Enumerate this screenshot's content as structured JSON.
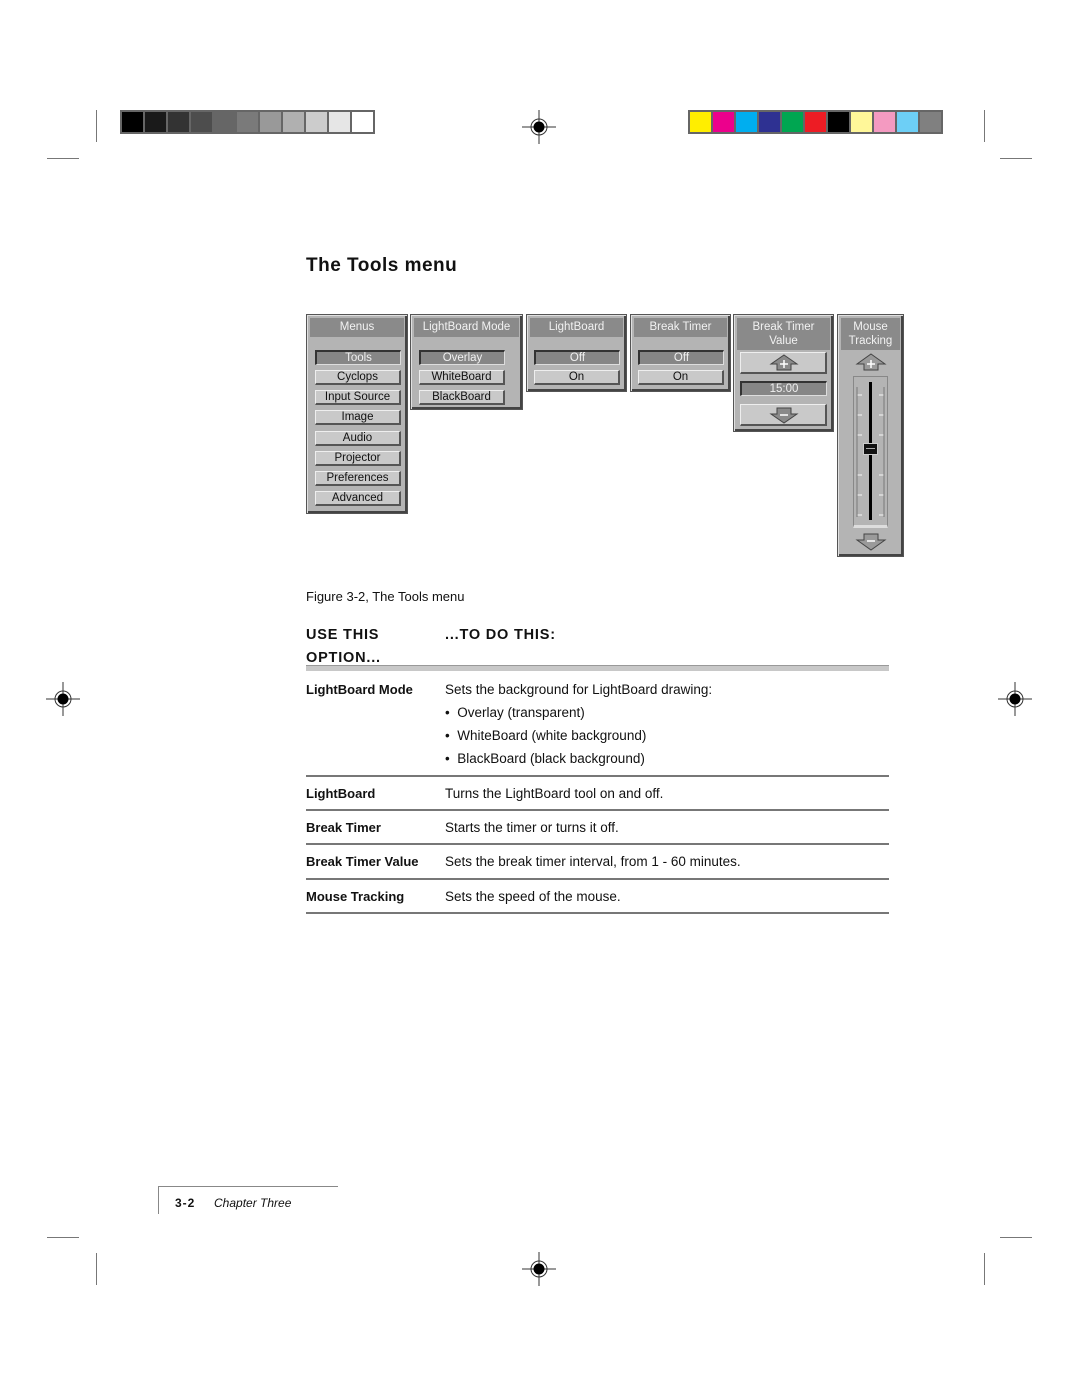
{
  "print_marks": {
    "grayscale_swatches": [
      "#000000",
      "#1a1a1a",
      "#333333",
      "#4d4d4d",
      "#666666",
      "#7a7a7a",
      "#999999",
      "#b0b0b0",
      "#cccccc",
      "#e6e6e6",
      "#ffffff"
    ],
    "color_swatches": [
      "#ffee00",
      "#ec008c",
      "#00aeef",
      "#2e3192",
      "#00a651",
      "#ed1c24",
      "#000000",
      "#fff799",
      "#f49ac1",
      "#6dcff6",
      "#808080"
    ]
  },
  "page_title": "The Tools menu",
  "figure": {
    "panels": {
      "menus": {
        "title": "Menus",
        "items": [
          {
            "label": "Tools",
            "selected": true
          },
          {
            "label": "Cyclops",
            "selected": false
          },
          {
            "label": "Input Source",
            "selected": false
          },
          {
            "label": "Image",
            "selected": false
          },
          {
            "label": "Audio",
            "selected": false
          },
          {
            "label": "Projector",
            "selected": false
          },
          {
            "label": "Preferences",
            "selected": false
          },
          {
            "label": "Advanced",
            "selected": false
          }
        ]
      },
      "lightboard_mode": {
        "title": "LightBoard Mode",
        "items": [
          {
            "label": "Overlay",
            "selected": true
          },
          {
            "label": "WhiteBoard",
            "selected": false
          },
          {
            "label": "BlackBoard",
            "selected": false
          }
        ]
      },
      "lightboard": {
        "title": "LightBoard",
        "items": [
          {
            "label": "Off",
            "selected": true
          },
          {
            "label": "On",
            "selected": false
          }
        ]
      },
      "break_timer": {
        "title": "Break Timer",
        "items": [
          {
            "label": "Off",
            "selected": true
          },
          {
            "label": "On",
            "selected": false
          }
        ]
      },
      "break_timer_value": {
        "title_line1": "Break Timer",
        "title_line2": "Value",
        "value": "15:00",
        "up_icon": "plus-up-arrow",
        "down_icon": "minus-down-arrow"
      },
      "mouse_tracking": {
        "title_line1": "Mouse",
        "title_line2": "Tracking",
        "slider_level_fraction": 0.5,
        "up_icon": "plus-up-arrow",
        "down_icon": "minus-down-arrow"
      }
    },
    "caption": "Figure 3-2, The Tools menu"
  },
  "table": {
    "header_col1_line1": "USE THIS",
    "header_col1_line2": "OPTION...",
    "header_col2": "...TO DO THIS:",
    "rows": [
      {
        "option": "LightBoard Mode",
        "description": "Sets the background for LightBoard drawing:",
        "bullets": [
          "Overlay (transparent)",
          "WhiteBoard (white background)",
          "BlackBoard (black background)"
        ]
      },
      {
        "option": "LightBoard",
        "description": "Turns the LightBoard tool on and off."
      },
      {
        "option": "Break Timer",
        "description": "Starts the timer or turns it off."
      },
      {
        "option": "Break Timer Value",
        "description": "Sets the break timer interval, from 1 - 60 minutes."
      },
      {
        "option": "Mouse Tracking",
        "description": "Sets the speed of the mouse."
      }
    ]
  },
  "footer": {
    "page_number": "3-2",
    "chapter": "Chapter Three"
  }
}
